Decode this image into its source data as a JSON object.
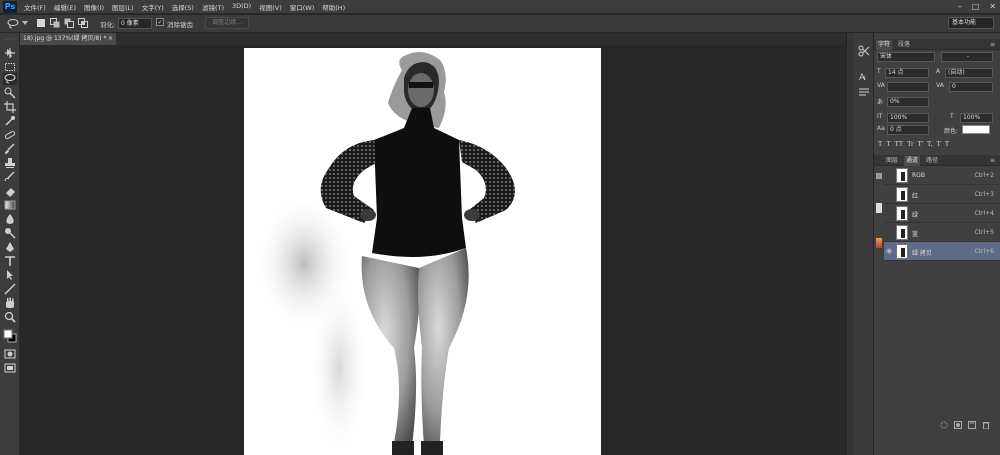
{
  "app": {
    "logo": "Ps",
    "menus": [
      "文件(F)",
      "编辑(E)",
      "图像(I)",
      "图层(L)",
      "文字(Y)",
      "选择(S)",
      "滤镜(T)",
      "3D(D)",
      "视图(V)",
      "窗口(W)",
      "帮助(H)"
    ],
    "window_controls": [
      "–",
      "□",
      "✕"
    ]
  },
  "options": {
    "feather_label": "羽化:",
    "feather_value": "0 像素",
    "antialias_label": "消除锯齿",
    "refine_edge": "调整边缘...",
    "workspace": "基本功能"
  },
  "document": {
    "tab_title": "18).jpg @ 137%(绿 拷贝/8) *",
    "tab_close": "×"
  },
  "character_panel": {
    "tabs": [
      "字符",
      "段落"
    ],
    "font_family": "宋体",
    "font_style": "-",
    "font_size": "14 点",
    "leading": "(自动)",
    "kerning": "",
    "tracking": "0",
    "tsume": "0%",
    "vertical_scale": "100%",
    "horizontal_scale": "100%",
    "baseline_shift": "0 点",
    "color_label": "颜色:",
    "type_styles": [
      "T",
      "T",
      "TT",
      "Tr",
      "T'",
      "T,",
      "T",
      "T"
    ]
  },
  "channels_panel": {
    "tabs": [
      "图层",
      "通道",
      "路径"
    ],
    "active_tab": 1,
    "rows": [
      {
        "name": "RGB",
        "shortcut": "Ctrl+2",
        "selected": false
      },
      {
        "name": "红",
        "shortcut": "Ctrl+3",
        "selected": false
      },
      {
        "name": "绿",
        "shortcut": "Ctrl+4",
        "selected": false
      },
      {
        "name": "蓝",
        "shortcut": "Ctrl+5",
        "selected": false
      },
      {
        "name": "绿 拷贝",
        "shortcut": "Ctrl+6",
        "selected": true
      }
    ]
  },
  "colors": {
    "annotation_arrow": "#d2232a",
    "selected_row": "#5d6b86"
  },
  "icons": {
    "tools": [
      "move-icon",
      "marquee-icon",
      "lasso-icon",
      "quick-select-icon",
      "crop-icon",
      "eyedropper-icon",
      "healing-icon",
      "brush-icon",
      "stamp-icon",
      "history-brush-icon",
      "eraser-icon",
      "gradient-icon",
      "blur-icon",
      "dodge-icon",
      "pen-icon",
      "type-icon",
      "path-select-icon",
      "shape-icon",
      "hand-icon",
      "zoom-icon"
    ]
  }
}
